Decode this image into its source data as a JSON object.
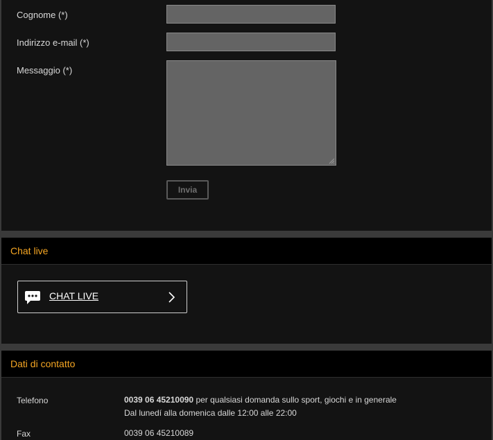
{
  "form": {
    "surname_label": "Cognome (*)",
    "email_label": "Indirizzo e-mail (*)",
    "message_label": "Messaggio (*)",
    "surname_value": "",
    "email_value": "",
    "message_value": "",
    "send_label": "Invia"
  },
  "chat": {
    "section_title": "Chat live",
    "button_label": "CHAT LIVE",
    "button_icon": "chat-bubble-icon",
    "button_arrow_icon": "chevron-right-icon"
  },
  "contact": {
    "section_title": "Dati di contatto",
    "phone_label": "Telefono",
    "phone_number": "0039 06 45210090",
    "phone_desc": " per qualsiasi domanda sullo sport, giochi e in generale",
    "phone_hours": "Dal lunedí alla domenica dalle 12:00 alle 22:00",
    "fax_label": "Fax",
    "fax_number": "0039 06 45210089"
  },
  "colors": {
    "accent": "#f5a623",
    "panel_bg": "#131313",
    "header_bg": "#000000",
    "input_bg": "#646464",
    "page_bg": "#3a3a3a"
  }
}
